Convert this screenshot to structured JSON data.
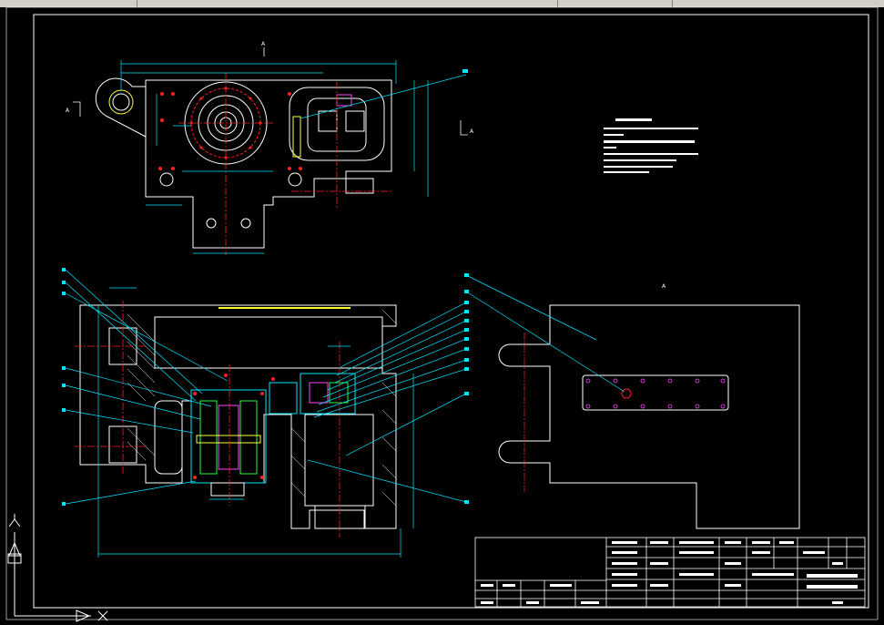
{
  "app": {
    "type": "cad-drawing-viewer",
    "background": "#000000"
  },
  "colors": {
    "frame": "#ffffff",
    "dimension": "#00e5ff",
    "centerline": "#ff2020",
    "leader": "#00e5ff",
    "magenta": "#ff40ff",
    "green": "#20ff40",
    "yellow": "#ffff30",
    "ucs": "#ffffff"
  },
  "view_markers": {
    "top_a": "A",
    "left_a": "A",
    "right_a": "A",
    "section_label": "A"
  },
  "notes_block": {
    "lines": 6
  },
  "balloon_count_left": 8,
  "balloon_count_right": 12,
  "title_block": {
    "rows": 5
  },
  "ucs": {
    "x_label": "X",
    "y_label": "Y"
  }
}
